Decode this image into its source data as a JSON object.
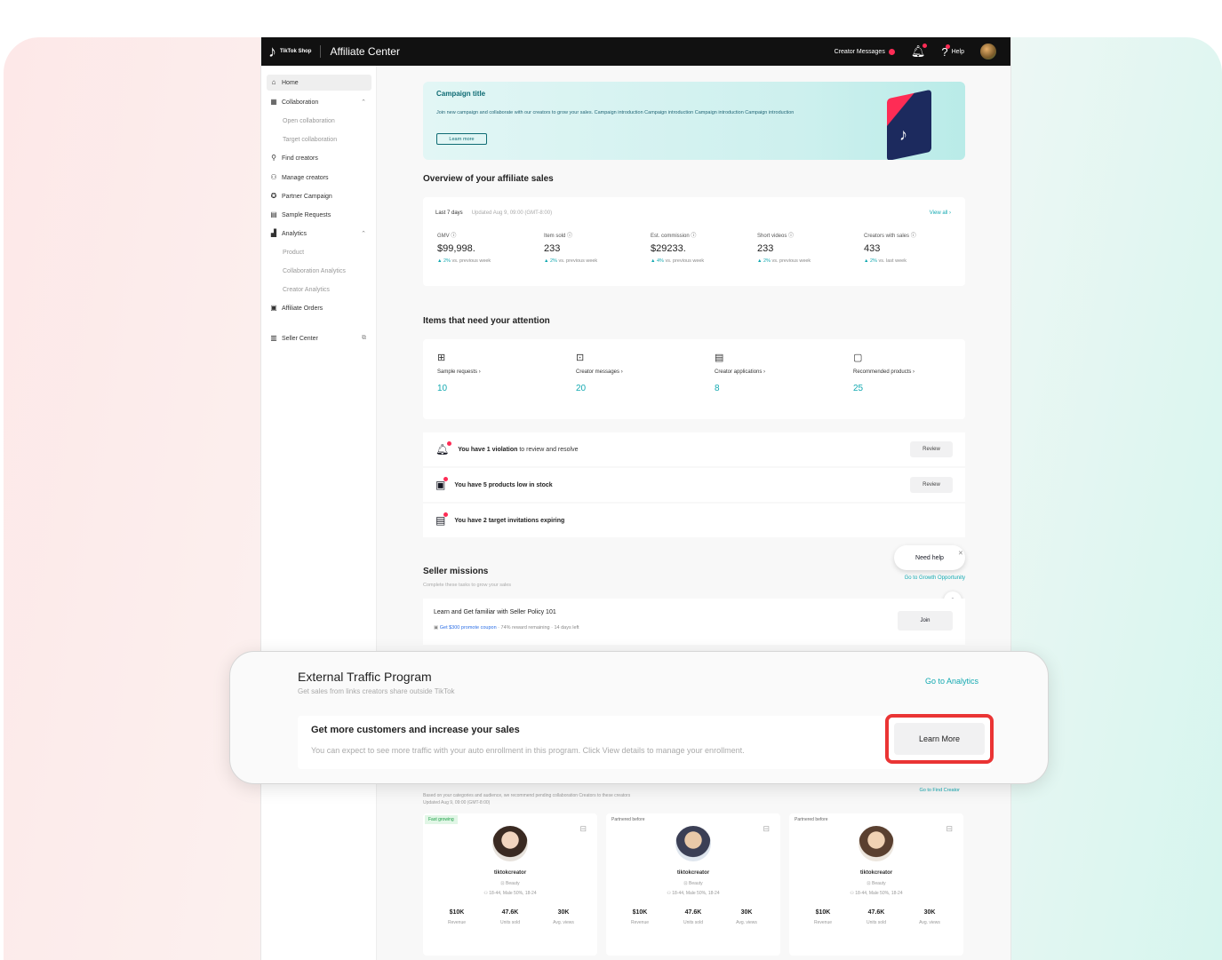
{
  "topbar": {
    "logo_text": "TikTok Shop",
    "app_title": "Affiliate Center",
    "creator_messages": "Creator Messages",
    "help": "Help"
  },
  "sidebar": {
    "items": [
      {
        "label": "Home",
        "icon": "home-icon"
      },
      {
        "label": "Collaboration",
        "icon": "collaboration-icon"
      },
      {
        "label": "Open collaboration",
        "icon": ""
      },
      {
        "label": "Target collaboration",
        "icon": ""
      },
      {
        "label": "Find creators",
        "icon": "person-icon"
      },
      {
        "label": "Manage creators",
        "icon": "people-icon"
      },
      {
        "label": "Partner Campaign",
        "icon": "campaign-icon"
      },
      {
        "label": "Sample Requests",
        "icon": "sample-icon"
      },
      {
        "label": "Analytics",
        "icon": "chart-icon"
      },
      {
        "label": "Product",
        "icon": ""
      },
      {
        "label": "Collaboration Analytics",
        "icon": ""
      },
      {
        "label": "Creator Analytics",
        "icon": ""
      },
      {
        "label": "Affiliate Orders",
        "icon": "orders-icon"
      },
      {
        "label": "Seller Center",
        "icon": "store-icon"
      }
    ]
  },
  "banner": {
    "title": "Campaign title",
    "description": "Join new campaign and collaborate with our creators to grow your sales. Campaign introduction Campaign introduction Campaign introduction Campaign introduction",
    "button": "Learn more"
  },
  "overview": {
    "title": "Overview of your affiliate sales",
    "period": "Last 7 days",
    "updated": "Updated Aug 9, 09:00 (GMT-8:00)",
    "view_all": "View all",
    "metrics": [
      {
        "label": "GMV",
        "value": "$99,998.",
        "change": "2%",
        "compare": "vs. previous week"
      },
      {
        "label": "Item sold",
        "value": "233",
        "change": "2%",
        "compare": "vs. previous week"
      },
      {
        "label": "Est. commission",
        "value": "$29233.",
        "change": "4%",
        "compare": "vs. previous week"
      },
      {
        "label": "Short videos",
        "value": "233",
        "change": "2%",
        "compare": "vs. previous week"
      },
      {
        "label": "Creators with sales",
        "value": "433",
        "change": "2%",
        "compare": "vs. last week"
      }
    ]
  },
  "attention": {
    "title": "Items that need your attention",
    "items": [
      {
        "label": "Sample requests",
        "value": "10",
        "icon": "gift-icon"
      },
      {
        "label": "Creator messages",
        "value": "20",
        "icon": "message-icon"
      },
      {
        "label": "Creator applications",
        "value": "8",
        "icon": "application-icon"
      },
      {
        "label": "Recommended products",
        "value": "25",
        "icon": "product-icon"
      }
    ]
  },
  "tasks": [
    {
      "bold": "You have 1 violation",
      "rest": " to review and resolve",
      "button": "Review",
      "icon": "bell-icon"
    },
    {
      "bold": "You have 5 products low in stock",
      "rest": "",
      "button": "Review",
      "icon": "box-icon"
    },
    {
      "bold": "You have 2 target invitations expiring",
      "rest": "",
      "button": "",
      "icon": "invitation-icon"
    }
  ],
  "need_help": "Need help",
  "missions": {
    "title": "Seller missions",
    "subtitle": "Complete these tasks to grow your sales",
    "link": "Go to Growth Opportunity",
    "item_title": "Learn and Get familiar with Seller Policy 101",
    "item_reward": "Get $300 promote coupon",
    "item_meta": " · 74% reward remaining · 14 days left",
    "join": "Join"
  },
  "creators": {
    "subtitle_line1": "Based on your categories and audience, we recommend pending collaboration Creators to these creators",
    "subtitle_line2": "Updated Aug 9, 09:00 (GMT-8:00)",
    "link": "Go to Find Creator",
    "cards": [
      {
        "tag": "Fast growing",
        "name": "tiktokcreator",
        "category": "Beauty",
        "demo": "18-44, Male 50%, 18-24",
        "stats": [
          {
            "v": "$10K",
            "k": "Revenue"
          },
          {
            "v": "47.6K",
            "k": "Units sold"
          },
          {
            "v": "30K",
            "k": "Avg. views"
          }
        ]
      },
      {
        "tag": "Partnered before",
        "name": "tiktokcreator",
        "category": "Beauty",
        "demo": "18-44, Male 50%, 18-24",
        "stats": [
          {
            "v": "$10K",
            "k": "Revenue"
          },
          {
            "v": "47.6K",
            "k": "Units sold"
          },
          {
            "v": "30K",
            "k": "Avg. views"
          }
        ]
      },
      {
        "tag": "Partnered before",
        "name": "tiktokcreator",
        "category": "Beauty",
        "demo": "18-44, Male 50%, 18-24",
        "stats": [
          {
            "v": "$10K",
            "k": "Revenue"
          },
          {
            "v": "47.6K",
            "k": "Units sold"
          },
          {
            "v": "30K",
            "k": "Avg. views"
          }
        ]
      }
    ]
  },
  "etp": {
    "title": "External Traffic Program",
    "subtitle": "Get sales from links creators share outside TikTok",
    "link": "Go to Analytics",
    "inner_title": "Get more customers and increase your sales",
    "inner_desc": "You can expect to see more traffic with your auto enrollment in this program. Click View details to manage your enrollment.",
    "button": "Learn More"
  },
  "colors": {
    "accent": "#13a9b1",
    "highlight": "#ea3434",
    "brand_red": "#fe2c55"
  }
}
